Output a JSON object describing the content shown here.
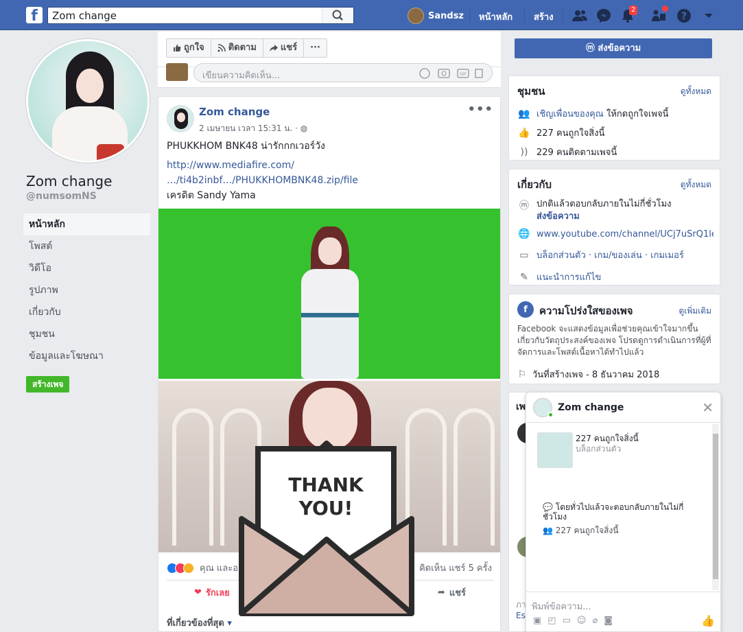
{
  "topbar": {
    "search_value": "Zom change",
    "user_name": "Sandsz",
    "home": "หน้าหลัก",
    "create": "สร้าง",
    "notifications_count": "2"
  },
  "profile": {
    "name": "Zom change",
    "handle": "@numsomNS"
  },
  "left_nav": {
    "items": [
      "หน้าหลัก",
      "โพสต์",
      "วิดีโอ",
      "รูปภาพ",
      "เกี่ยวกับ",
      "ชุมชน",
      "ข้อมูลและโฆษณา"
    ],
    "create_page": "สร้างเพจ"
  },
  "actions": {
    "like": "ถูกใจ",
    "follow": "ติดตาม",
    "share": "แชร์",
    "more": "···",
    "send_message": "ส่งข้อความ"
  },
  "composer": {
    "placeholder": "เขียนความคิดเห็น..."
  },
  "post": {
    "author": "Zom change",
    "time": "2 เมษายน เวลา 15:31 น. · ",
    "text": "PHUKKHOM BNK48 น่ารักกกเวอร์วัง",
    "link1": "http://www.mediafire.com/",
    "link2": "…/ti4b2inbf…/PHUKKHOMBNK48.zip/file",
    "credit": "เครดิต Sandy Yama",
    "reactions_text": "คุณ และอ",
    "stats": "คิดเห็น  แชร์ 5 ครั้ง",
    "love_label": "รักเลย",
    "share_label": "แชร์",
    "relevant": "ที่เกี่ยวข้องที่สุด",
    "thank_you_line1": "THANK",
    "thank_you_line2": "YOU!"
  },
  "community": {
    "title": "ชุมชน",
    "see_all": "ดูทั้งหมด",
    "invite_link": "เชิญเพื่อนของคุณ",
    "invite_rest": " ให้กดถูกใจเพจนี้",
    "likes": "227 คนถูกใจสิ่งนี้",
    "followers": "229 คนติดตามเพจนี้"
  },
  "about": {
    "title": "เกี่ยวกับ",
    "see_all": "ดูทั้งหมด",
    "response": "ปกติแล้วตอบกลับภายในไม่กี่ชั่วโมง",
    "send_message": "ส่งข้อความ",
    "youtube": "www.youtube.com/channel/UCj7uSrQ1let",
    "categories": "บล็อกส่วนตัว · เกม/ของเล่น · เกมเมอร์",
    "suggest_edit": "แนะนำการแก้ไข"
  },
  "transparency": {
    "title": "ความโปร่งใสของเพจ",
    "see_more": "ดูเพิ่มเติม",
    "body": "Facebook จะแสดงข้อมูลเพื่อช่วยคุณเข้าใจมากขึ้นเกี่ยวกับวัตถุประสงค์ของเพจ โปรดดูการดำเนินการที่ผู้ที่จัดการและโพสต์เนื้อหาได้ทำไปแล้ว",
    "created": "วันที่สร้างเพจ - 8 ธันวาคม 2018"
  },
  "hidden_card": {
    "title_fragment": "เพ",
    "bottom_fragment_1": "ภา",
    "bottom_fragment_2": "Es"
  },
  "chat": {
    "title": "Zom change",
    "likes": "227 คนถูกใจสิ่งนี้",
    "category": "บล็อกส่วนตัว",
    "response": "โดยทั่วไปแล้วจะตอบกลับภายในไม่กี่ชั่วโมง",
    "likes2": "227 คนถูกใจสิ่งนี้",
    "placeholder": "พิมพ์ข้อความ..."
  },
  "colors": {
    "brand": "#4267b2",
    "link": "#365899",
    "green": "#42b72a",
    "notification": "#fa3e3e"
  }
}
